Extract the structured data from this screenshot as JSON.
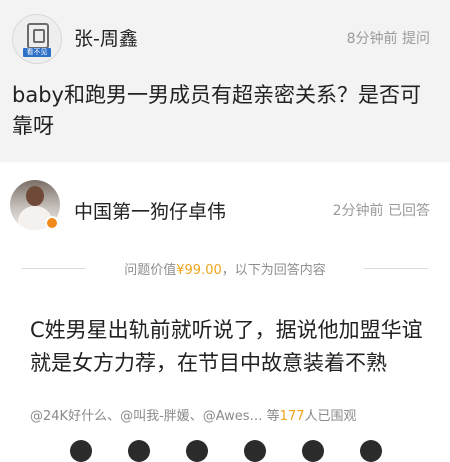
{
  "question": {
    "asker_name": "张-周鑫",
    "time": "8分钟前",
    "action": "提问",
    "text": "baby和跑男一男成员有超亲密关系？是否可靠呀",
    "avatar_badge_text": "看不见"
  },
  "answer": {
    "answerer_name": "中国第一狗仔卓伟",
    "time": "2分钟前",
    "status": "已回答",
    "price_prefix": "问题价值",
    "price": "¥99.00",
    "price_suffix": "，以下为回答内容",
    "text": "C姓男星出轨前就听说了，据说他加盟华谊就是女方力荐，在节目中故意装着不熟"
  },
  "viewers": {
    "names": "@24K好什么、@叫我-胖媛、@Awes… 等",
    "count": "177",
    "suffix": "人已围观"
  },
  "colors": {
    "question_bg": "#f3f3f3",
    "accent_orange": "#f0a51a",
    "meta_gray": "#9a9a9a"
  }
}
